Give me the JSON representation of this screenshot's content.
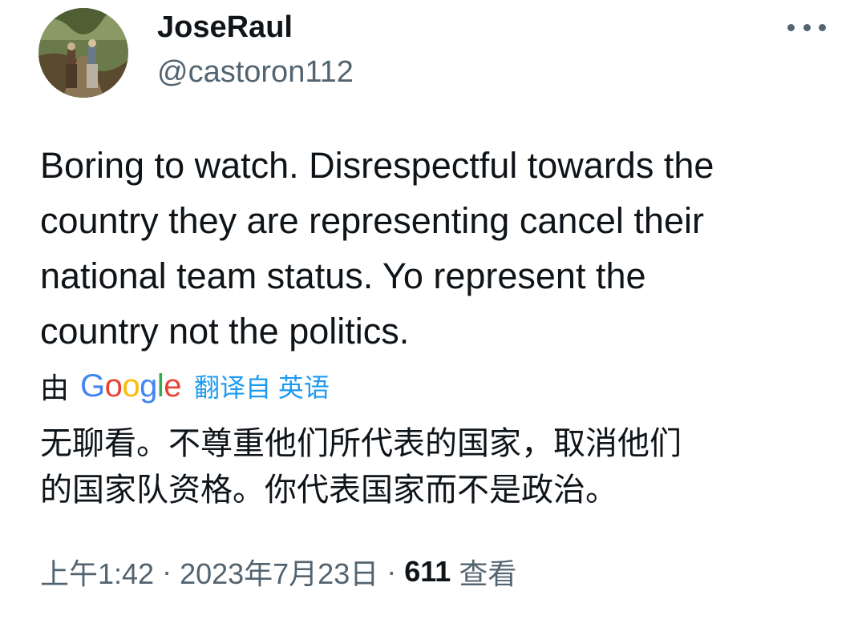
{
  "tweet": {
    "display_name": "JoseRaul",
    "handle": "@castoron112",
    "text": "Boring to watch. Disrespectful towards the\ncountry they are representing cancel their\nnational team status. Yo represent the\ncountry not the politics.",
    "translation": {
      "by_label": "由",
      "provider": "Google",
      "link_text": "翻译自 英语",
      "text": "无聊看。不尊重他们所代表的国家，取消他们\n的国家队资格。你代表国家而不是政治。"
    },
    "meta": {
      "time": "上午1:42",
      "separator": "·",
      "date": "2023年7月23日",
      "views_count": "611",
      "views_label": "查看"
    },
    "icons": {
      "more": "more-horizontal-icon",
      "avatar": "avatar-image"
    },
    "colors": {
      "link": "#1d9bf0",
      "secondary_text": "#536471",
      "primary_text": "#0f1419"
    }
  }
}
